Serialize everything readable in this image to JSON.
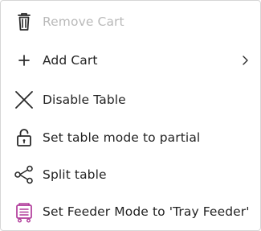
{
  "menu": {
    "items": [
      {
        "label": "Remove Cart",
        "icon": "trash-icon",
        "disabled": true
      },
      {
        "label": "Add Cart",
        "icon": "plus-icon",
        "has_submenu": true,
        "submenu_icon": "chevron-right-icon"
      },
      {
        "label": "Disable Table",
        "icon": "close-icon"
      },
      {
        "label": "Set table mode to partial",
        "icon": "unlock-icon"
      },
      {
        "label": "Split table",
        "icon": "share-icon"
      },
      {
        "label": "Set Feeder Mode to 'Tray Feeder'",
        "icon": "tray-feeder-icon"
      }
    ],
    "colors": {
      "text": "#222222",
      "disabled_text": "#b9b9b9",
      "icon": "#222222",
      "feeder_icon": "#b03a9a",
      "border": "#d6d6d6"
    }
  }
}
